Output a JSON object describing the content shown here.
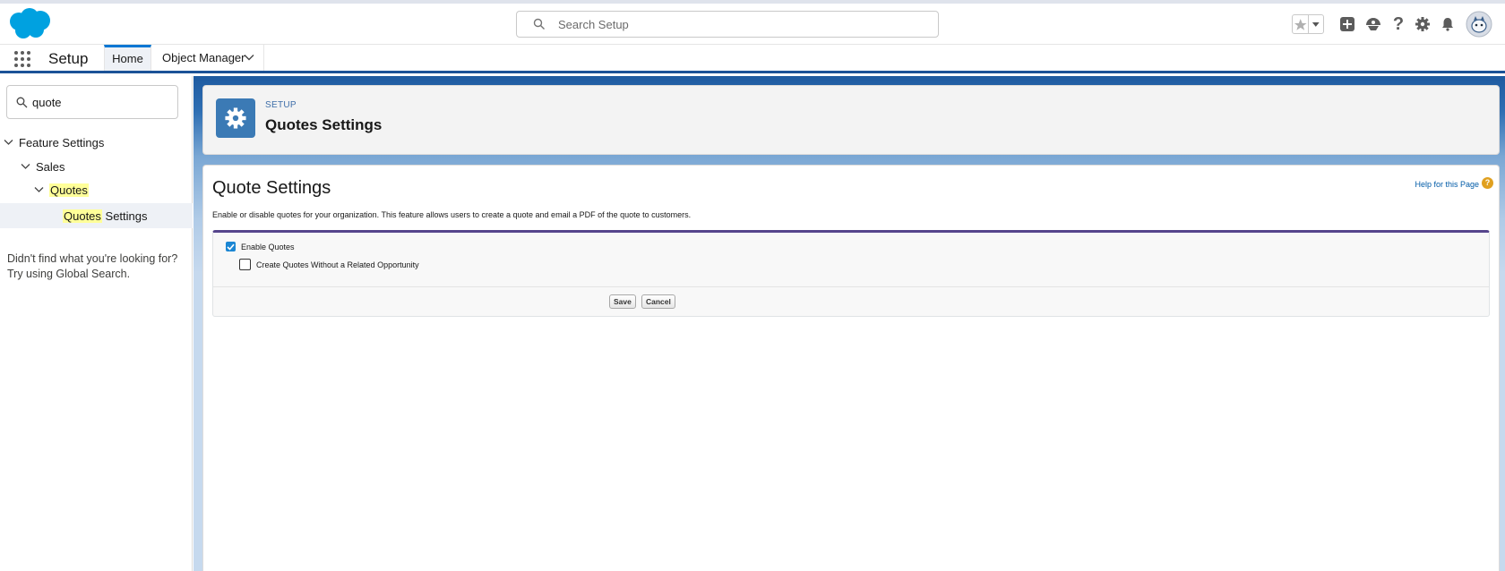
{
  "header": {
    "search_placeholder": "Search Setup",
    "icons": [
      "favorites-star-icon",
      "favorites-dropdown-icon",
      "global-actions-icon",
      "trailhead-icon",
      "help-icon",
      "setup-gear-icon",
      "notifications-bell-icon",
      "avatar"
    ]
  },
  "context_bar": {
    "app_name": "Setup",
    "tabs": [
      {
        "label": "Home",
        "active": true
      },
      {
        "label": "Object Manager",
        "active": false
      }
    ]
  },
  "sidebar": {
    "quick_find_value": "quote",
    "tree": {
      "feature_settings": "Feature Settings",
      "sales": "Sales",
      "quotes": "Quotes",
      "quotes_settings_match": "Quotes",
      "quotes_settings_rest": " Settings"
    },
    "help_line1": "Didn't find what you're looking for?",
    "help_line2": "Try using Global Search."
  },
  "page_header": {
    "eyebrow": "SETUP",
    "title": "Quotes Settings"
  },
  "content": {
    "title": "Quote Settings",
    "help_link": "Help for this Page",
    "description": "Enable or disable quotes for your organization. This feature allows users to create a quote and email a PDF of the quote to customers.",
    "enable_quotes": {
      "label": "Enable Quotes",
      "checked": true
    },
    "without_opportunity": {
      "label": "Create Quotes Without a Related Opportunity",
      "checked": false
    },
    "save_label": "Save",
    "cancel_label": "Cancel"
  },
  "colors": {
    "brand_blue": "#0176d3",
    "header_band": "#1e5aa0",
    "setup_icon_bg": "#3b7ab5",
    "checkbox_blue": "#1b86d3",
    "search_highlight": "#ffff99"
  }
}
